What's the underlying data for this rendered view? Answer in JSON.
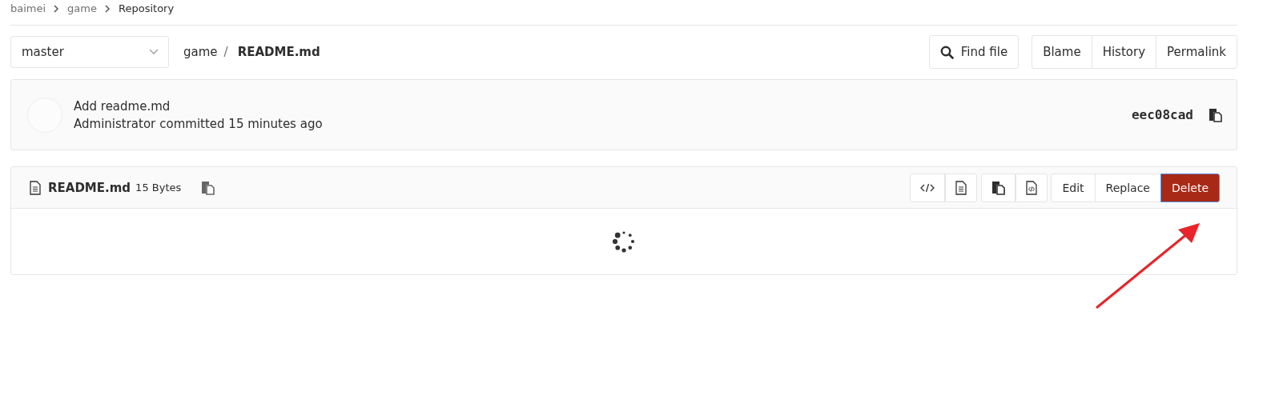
{
  "breadcrumbs": [
    {
      "label": "baimei",
      "current": false
    },
    {
      "label": "game",
      "current": false
    },
    {
      "label": "Repository",
      "current": true
    }
  ],
  "branch": {
    "value": "master"
  },
  "path": {
    "parent": "game",
    "separator": "/",
    "file": "README.md"
  },
  "find_button": "Find file",
  "view_buttons": [
    "Blame",
    "History",
    "Permalink"
  ],
  "commit": {
    "title": "Add readme.md",
    "author": "Administrator",
    "action": "committed 15 minutes ago",
    "sha": "eec08cad"
  },
  "file": {
    "name": "README.md",
    "size": "15 Bytes",
    "actions": [
      {
        "label": "Edit",
        "kind": "default"
      },
      {
        "label": "Replace",
        "kind": "default"
      },
      {
        "label": "Delete",
        "kind": "danger"
      }
    ]
  }
}
